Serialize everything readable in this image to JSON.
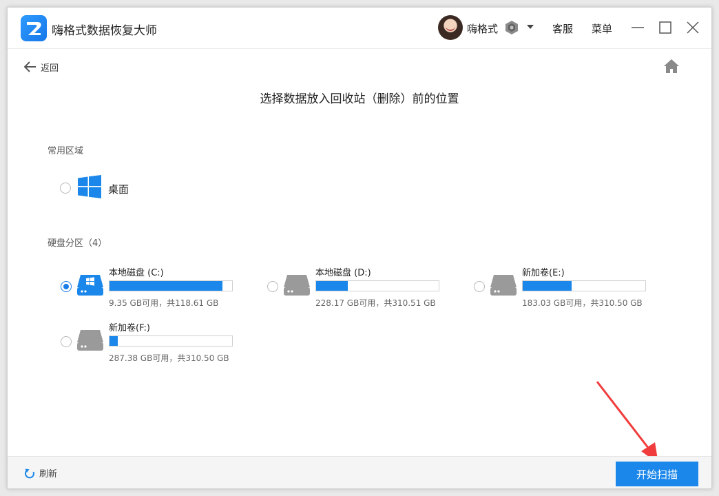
{
  "app": {
    "title": "嗨格式数据恢复大师",
    "user_name": "嗨格式",
    "support_label": "客服",
    "menu_label": "菜单"
  },
  "nav": {
    "back_label": "返回"
  },
  "page": {
    "title": "选择数据放入回收站（删除）前的位置"
  },
  "common_area": {
    "label": "常用区域",
    "items": [
      {
        "label": "桌面",
        "icon": "windows-logo-icon",
        "selected": false
      }
    ]
  },
  "partitions": {
    "label": "硬盘分区（4）",
    "drives": [
      {
        "name": "本地磁盘 (C:)",
        "info": "9.35 GB可用，共118.61 GB",
        "used_fraction": 0.92,
        "system": true,
        "selected": true
      },
      {
        "name": "本地磁盘 (D:)",
        "info": "228.17 GB可用，共310.51 GB",
        "used_fraction": 0.26,
        "system": false,
        "selected": false
      },
      {
        "name": "新加卷(E:)",
        "info": "183.03 GB可用，共310.50 GB",
        "used_fraction": 0.4,
        "system": false,
        "selected": false
      },
      {
        "name": "新加卷(F:)",
        "info": "287.38 GB可用，共310.50 GB",
        "used_fraction": 0.07,
        "system": false,
        "selected": false
      }
    ]
  },
  "footer": {
    "refresh_label": "刷新",
    "start_label": "开始扫描"
  },
  "colors": {
    "accent": "#1b87ea",
    "annotation_arrow": "#f03c3c"
  }
}
